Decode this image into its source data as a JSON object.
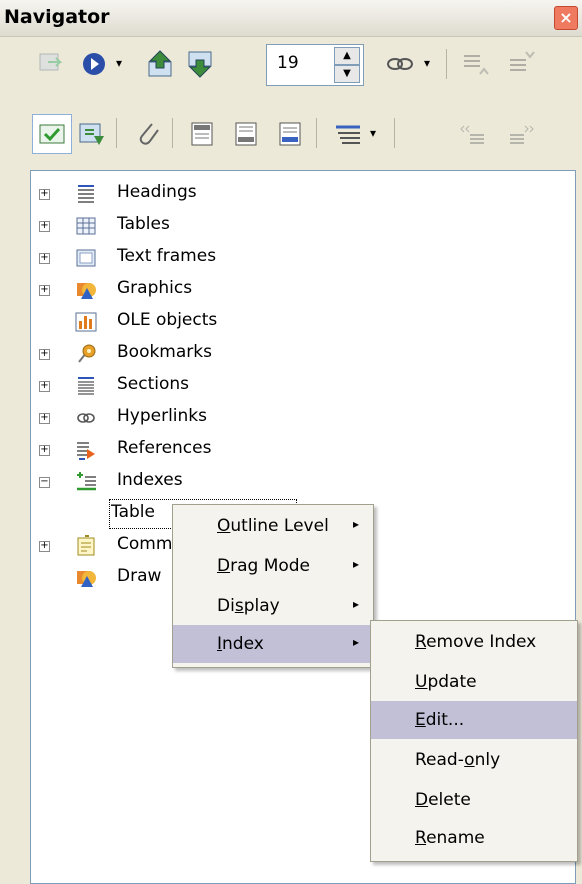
{
  "window": {
    "title": "Navigator",
    "close": "×"
  },
  "toolbar": {
    "page_number": "19",
    "spin_up": "▲",
    "spin_down": "▼",
    "dropdown_arrow": "▾"
  },
  "tree": {
    "expand_plus": "+",
    "expand_minus": "−",
    "items": [
      {
        "label": "Headings",
        "icon": "headings-icon"
      },
      {
        "label": "Tables",
        "icon": "table-icon"
      },
      {
        "label": "Text frames",
        "icon": "text-frame-icon"
      },
      {
        "label": "Graphics",
        "icon": "graphics-icon"
      },
      {
        "label": "OLE objects",
        "icon": "ole-objects-icon"
      },
      {
        "label": "Bookmarks",
        "icon": "bookmark-icon"
      },
      {
        "label": "Sections",
        "icon": "sections-icon"
      },
      {
        "label": "Hyperlinks",
        "icon": "hyperlink-icon"
      },
      {
        "label": "References",
        "icon": "references-icon"
      },
      {
        "label": "Indexes",
        "icon": "indexes-icon"
      },
      {
        "label": "Table",
        "icon": ""
      },
      {
        "label": "Comm",
        "icon": "comment-icon"
      },
      {
        "label": "Draw",
        "icon": "draw-objects-icon"
      }
    ]
  },
  "context_menu": {
    "items": [
      {
        "label_pre": "",
        "label_u": "O",
        "label_post": "utline Level",
        "arrow": "▸"
      },
      {
        "label_pre": "",
        "label_u": "D",
        "label_post": "rag Mode",
        "arrow": "▸"
      },
      {
        "label_pre": "Di",
        "label_u": "s",
        "label_post": "play",
        "arrow": "▸"
      },
      {
        "label_pre": "",
        "label_u": "I",
        "label_post": "ndex",
        "arrow": "▸"
      }
    ]
  },
  "submenu": {
    "items": [
      {
        "label_pre": "",
        "label_u": "R",
        "label_post": "emove Index"
      },
      {
        "label_pre": "",
        "label_u": "U",
        "label_post": "pdate"
      },
      {
        "label_pre": "",
        "label_u": "E",
        "label_post": "dit..."
      },
      {
        "label_pre": "Read-",
        "label_u": "o",
        "label_post": "nly"
      },
      {
        "label_pre": "",
        "label_u": "D",
        "label_post": "elete"
      },
      {
        "label_pre": "",
        "label_u": "R",
        "label_post": "ename"
      }
    ]
  }
}
